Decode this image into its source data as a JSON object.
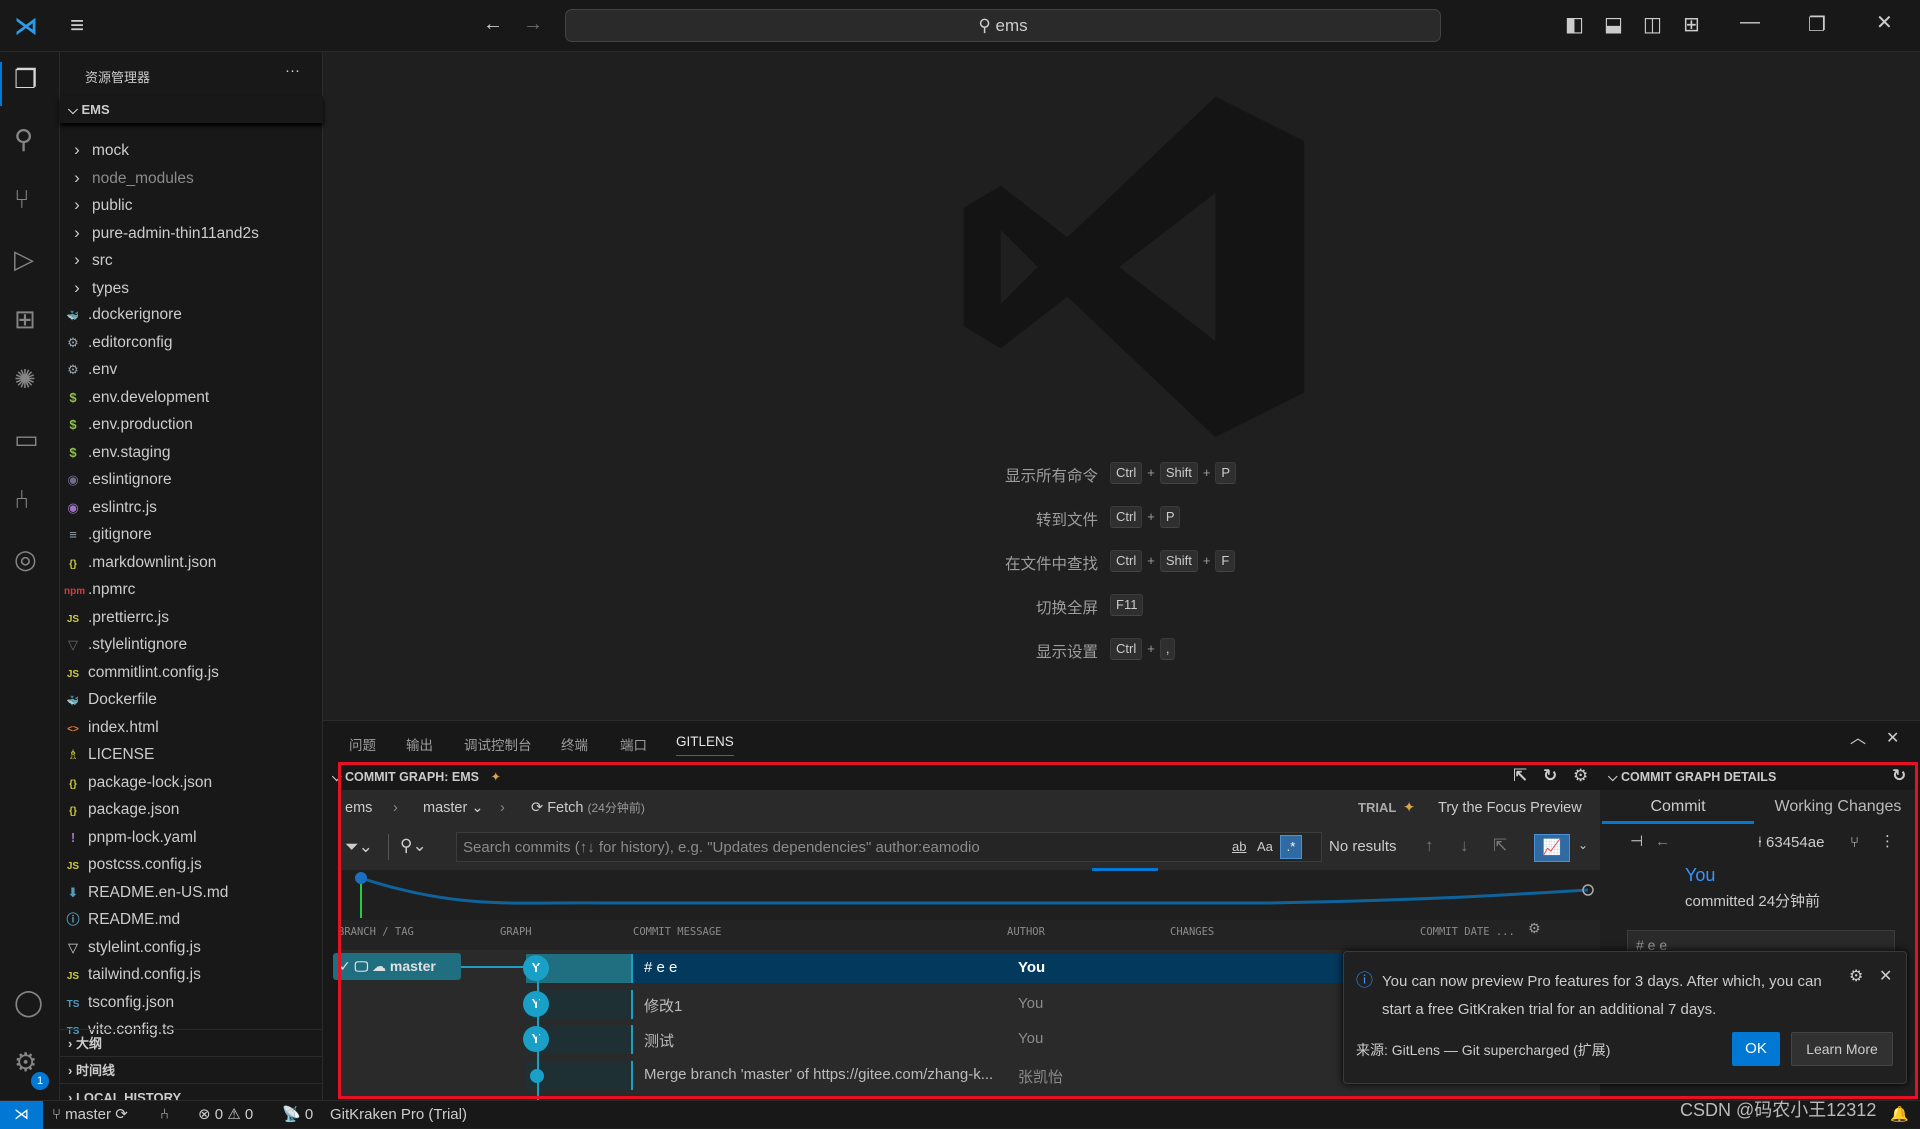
{
  "titlebar": {
    "search_text": "ems"
  },
  "explorer": {
    "title": "资源管理器",
    "more_label": "···",
    "root": "EMS",
    "items": [
      {
        "name": "mock",
        "type": "folder"
      },
      {
        "name": "node_modules",
        "type": "folder",
        "dim": true
      },
      {
        "name": "public",
        "type": "folder"
      },
      {
        "name": "pure-admin-thin11and2s",
        "type": "folder"
      },
      {
        "name": "src",
        "type": "folder"
      },
      {
        "name": "types",
        "type": "folder"
      },
      {
        "name": ".dockerignore",
        "icon": "docker-icon",
        "glyph": "🐳",
        "color": "#5f7f9f"
      },
      {
        "name": ".editorconfig",
        "icon": "gear-icon",
        "glyph": "⚙",
        "color": "#9aa3ad"
      },
      {
        "name": ".env",
        "icon": "gear-icon",
        "glyph": "⚙",
        "color": "#9aa3ad"
      },
      {
        "name": ".env.development",
        "icon": "dollar-icon",
        "glyph": "$",
        "color": "#8dc149"
      },
      {
        "name": ".env.production",
        "icon": "dollar-icon",
        "glyph": "$",
        "color": "#8dc149"
      },
      {
        "name": ".env.staging",
        "icon": "dollar-icon",
        "glyph": "$",
        "color": "#8dc149"
      },
      {
        "name": ".eslintignore",
        "icon": "eslint-icon",
        "glyph": "◉",
        "color": "#6d6d8a"
      },
      {
        "name": ".eslintrc.js",
        "icon": "eslint-icon",
        "glyph": "◉",
        "color": "#a074c4"
      },
      {
        "name": ".gitignore",
        "icon": "lines-icon",
        "glyph": "≡",
        "color": "#9aa3ad"
      },
      {
        "name": ".markdownlint.json",
        "icon": "braces-icon",
        "glyph": "{}",
        "color": "#cbcb41"
      },
      {
        "name": ".npmrc",
        "icon": "npm-icon",
        "glyph": "npm",
        "color": "#cc3e44"
      },
      {
        "name": ".prettierrc.js",
        "icon": "js-icon",
        "glyph": "JS",
        "color": "#cbcb41"
      },
      {
        "name": ".stylelintignore",
        "icon": "stylelint-icon",
        "glyph": "▽",
        "color": "#6d6d6d"
      },
      {
        "name": "commitlint.config.js",
        "icon": "js-icon",
        "glyph": "JS",
        "color": "#cbcb41"
      },
      {
        "name": "Dockerfile",
        "icon": "docker-icon",
        "glyph": "🐳",
        "color": "#519aba"
      },
      {
        "name": "index.html",
        "icon": "html-icon",
        "glyph": "<>",
        "color": "#e37933"
      },
      {
        "name": "LICENSE",
        "icon": "license-icon",
        "glyph": "♗",
        "color": "#cbcb41"
      },
      {
        "name": "package-lock.json",
        "icon": "braces-icon",
        "glyph": "{}",
        "color": "#cbcb41"
      },
      {
        "name": "package.json",
        "icon": "braces-icon",
        "glyph": "{}",
        "color": "#cbcb41"
      },
      {
        "name": "pnpm-lock.yaml",
        "icon": "exclamation-icon",
        "glyph": "!",
        "color": "#a074c4"
      },
      {
        "name": "postcss.config.js",
        "icon": "js-icon",
        "glyph": "JS",
        "color": "#cbcb41"
      },
      {
        "name": "README.en-US.md",
        "icon": "download-icon",
        "glyph": "⬇",
        "color": "#519aba"
      },
      {
        "name": "README.md",
        "icon": "info-icon",
        "glyph": "ⓘ",
        "color": "#519aba"
      },
      {
        "name": "stylelint.config.js",
        "icon": "stylelint-icon",
        "glyph": "▽",
        "color": "#d4d7d6"
      },
      {
        "name": "tailwind.config.js",
        "icon": "js-icon",
        "glyph": "JS",
        "color": "#cbcb41"
      },
      {
        "name": "tsconfig.json",
        "icon": "ts-icon",
        "glyph": "TS",
        "color": "#519aba"
      },
      {
        "name": "vite.config.ts",
        "icon": "ts-icon",
        "glyph": "TS",
        "color": "#519aba"
      }
    ],
    "sections": [
      "大纲",
      "时间线",
      "LOCAL HISTORY"
    ]
  },
  "editor": {
    "shortcuts": [
      {
        "label": "显示所有命令",
        "keys": [
          "Ctrl",
          "Shift",
          "P"
        ]
      },
      {
        "label": "转到文件",
        "keys": [
          "Ctrl",
          "P"
        ]
      },
      {
        "label": "在文件中查找",
        "keys": [
          "Ctrl",
          "Shift",
          "F"
        ]
      },
      {
        "label": "切换全屏",
        "keys": [
          "F11"
        ]
      },
      {
        "label": "显示设置",
        "keys": [
          "Ctrl",
          ","
        ]
      }
    ]
  },
  "panel": {
    "tabs": [
      "问题",
      "输出",
      "调试控制台",
      "终端",
      "端口",
      "GITLENS"
    ],
    "active_tab": "GITLENS"
  },
  "graph": {
    "title": "COMMIT GRAPH: EMS",
    "repo": "ems",
    "branch": "master",
    "fetch_label": "Fetch",
    "fetch_time": "(24分钟前)",
    "trial_label": "TRIAL",
    "focus_label": "Try the Focus Preview",
    "search_placeholder": "Search commits (↑↓ for history), e.g. \"Updates dependencies\" author:eamodio",
    "search_opt_word": "ab",
    "search_opt_case": "Aa",
    "search_opt_regex": ".*",
    "search_result": "No results",
    "columns": [
      "BRANCH / TAG",
      "GRAPH",
      "COMMIT MESSAGE",
      "AUTHOR",
      "CHANGES",
      "COMMIT DATE ..."
    ],
    "branch_tag": "master",
    "rows": [
      {
        "avatar": "Y",
        "message": "# e e",
        "author": "You",
        "selected": true
      },
      {
        "avatar": "Y",
        "message": "修改1",
        "author": "You"
      },
      {
        "avatar": "Y",
        "message": "测试",
        "author": "You"
      },
      {
        "avatar": "",
        "message": "Merge branch 'master' of https://gitee.com/zhang-k...",
        "author": "张凯怡"
      }
    ],
    "accent": "#1a9fc7"
  },
  "details": {
    "title": "COMMIT GRAPH DETAILS",
    "tabs": [
      "Commit",
      "Working Changes"
    ],
    "sha": "63454ae",
    "author": "You",
    "committed": "committed 24分钟前",
    "message_preview": "# e e"
  },
  "notification": {
    "message": "You can now preview Pro features for 3 days. After which, you can start a free GitKraken trial for an additional 7 days.",
    "source": "来源: GitLens — Git supercharged (扩展)",
    "ok_label": "OK",
    "learn_more_label": "Learn More"
  },
  "statusbar": {
    "branch": "master",
    "errors": "0",
    "warnings": "0",
    "ports": "0",
    "gitkraken": "GitKraken Pro (Trial)",
    "watermark": "CSDN @码农小王12312"
  },
  "activity": {
    "settings_badge": "1"
  },
  "colors": {
    "accent": "#0078d4",
    "highlight_border": "#e81123",
    "selected_row": "#04395e"
  }
}
